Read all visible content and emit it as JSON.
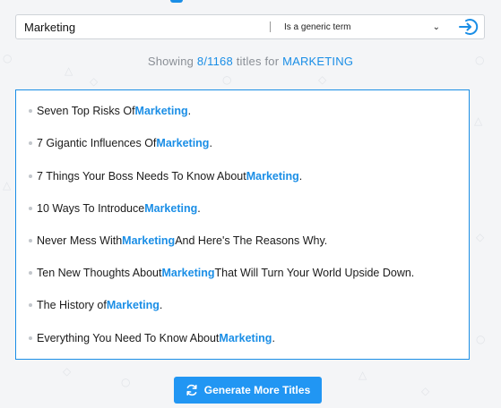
{
  "search": {
    "value": "Marketing",
    "select_value": "Is a generic term",
    "go_icon": "arrow-right-circle-icon"
  },
  "status": {
    "prefix": "Showing ",
    "count": "8/1168",
    "middle": " titles for ",
    "term": "MARKETING"
  },
  "titles": [
    {
      "before": "Seven Top Risks Of ",
      "keyword": "Marketing",
      "after": "."
    },
    {
      "before": "7 Gigantic Influences Of ",
      "keyword": "Marketing",
      "after": "."
    },
    {
      "before": "7 Things Your Boss Needs To Know About ",
      "keyword": "Marketing",
      "after": "."
    },
    {
      "before": "10 Ways To Introduce ",
      "keyword": "Marketing",
      "after": "."
    },
    {
      "before": "Never Mess With ",
      "keyword": "Marketing",
      "after": " And Here's The Reasons Why."
    },
    {
      "before": "Ten New Thoughts About ",
      "keyword": "Marketing",
      "after": " That Will Turn Your World Upside Down."
    },
    {
      "before": "The History of ",
      "keyword": "Marketing",
      "after": "."
    },
    {
      "before": "Everything You Need To Know About ",
      "keyword": "Marketing",
      "after": "."
    }
  ],
  "generate_button": {
    "label": "Generate More Titles",
    "icon": "refresh-icon"
  },
  "colors": {
    "accent": "#1a8ee6",
    "button": "#2196f3",
    "background": "#f4f5f7"
  }
}
